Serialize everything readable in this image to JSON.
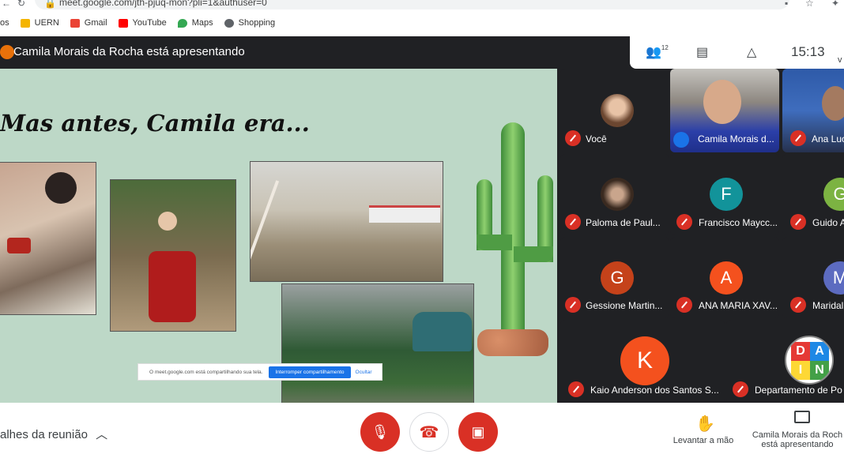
{
  "browser": {
    "url": "meet.google.com/jth-pjuq-mon?pli=1&authuser=0",
    "bookmarks_cut": "os",
    "bookmarks": [
      {
        "label": "UERN",
        "icon": "folder-icon",
        "color": "#f4b400"
      },
      {
        "label": "Gmail",
        "icon": "gmail-icon",
        "color": "#ea4335"
      },
      {
        "label": "YouTube",
        "icon": "youtube-icon",
        "color": "#ff0000"
      },
      {
        "label": "Maps",
        "icon": "maps-pin-icon",
        "color": "#34a853"
      },
      {
        "label": "Shopping",
        "icon": "shopping-icon",
        "color": "#5f6368"
      }
    ]
  },
  "meeting": {
    "presenting_title": "Camila Morais da Rocha está apresentando",
    "participant_count": "12",
    "time": "15:13",
    "side_char": "v"
  },
  "slide": {
    "title": "Mas antes, Camila era...",
    "share_banner": {
      "text": "O meet.google.com está compartilhando sua tela.",
      "stop_label": "Interromper compartilhamento",
      "hide_label": "Ocultar"
    }
  },
  "tiles": [
    {
      "name": "Você",
      "type": "photo"
    },
    {
      "name": "Camila Morais d...",
      "type": "video"
    },
    {
      "name": "Ana Luc",
      "type": "video"
    },
    {
      "name": "Paloma de Paul...",
      "type": "photo"
    },
    {
      "name": "Francisco Maycc...",
      "initial": "F",
      "color": "#12939a"
    },
    {
      "name": "Guido A",
      "initial": "G",
      "color": "#7cb342"
    },
    {
      "name": "Gessione Martin...",
      "initial": "G",
      "color": "#c5421a"
    },
    {
      "name": "ANA MARIA XAV...",
      "initial": "A",
      "color": "#f4511e"
    },
    {
      "name": "Maridal",
      "initial": "M",
      "color": "#5c6bc0"
    },
    {
      "name": "Kaio Anderson dos Santos S...",
      "initial": "K",
      "color": "#f4511e"
    },
    {
      "name": "Departamento de Po",
      "type": "logo",
      "logo_letters": [
        "D",
        "A",
        "I",
        "N"
      ]
    }
  ],
  "bottom": {
    "details_label": "alhes da reunião",
    "raise_hand_label": "Levantar a mão",
    "presenting_line1": "Camila Morais da Roch",
    "presenting_line2": "está apresentando"
  },
  "colors": {
    "dark_bg": "#202124",
    "tile_bg": "#3c4043",
    "danger_red": "#d93025",
    "slide_bg": "#bdd8c7",
    "accent_blue": "#1a73e8"
  }
}
